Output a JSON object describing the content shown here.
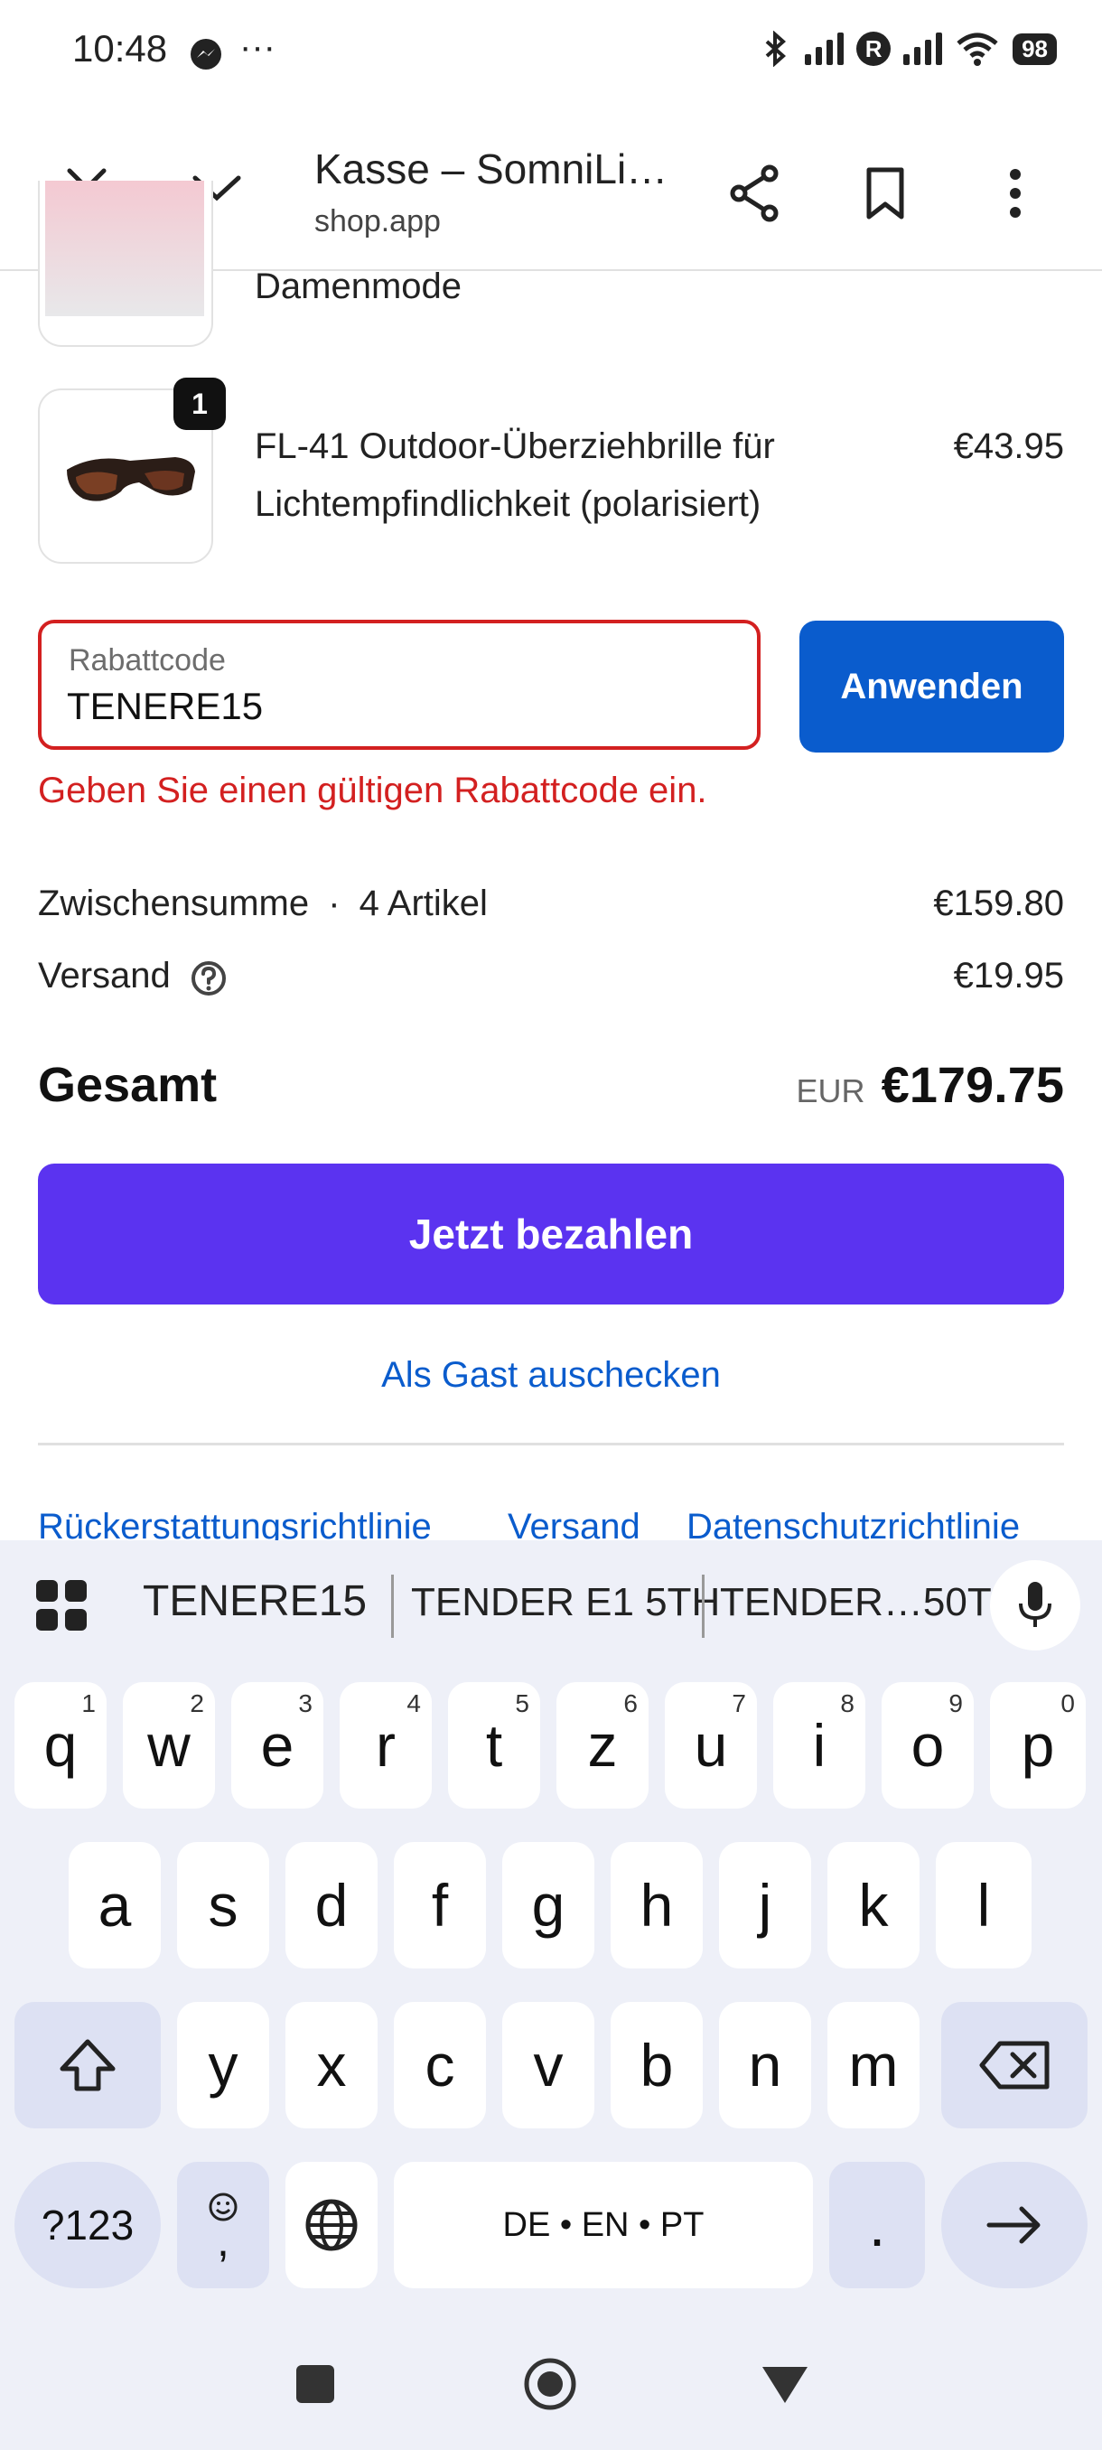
{
  "status": {
    "time": "10:48",
    "battery": "98",
    "r_badge": "R"
  },
  "header": {
    "title": "Kasse – SomniLi…",
    "url": "shop.app"
  },
  "items": [
    {
      "name": "Damenmode"
    },
    {
      "name_line1": "FL-41 Outdoor-Überziehbrille für",
      "name_line2": "Lichtempfindlichkeit (polarisiert)",
      "price": "€43.95",
      "qty": "1"
    }
  ],
  "discount": {
    "label": "Rabattcode",
    "value": "TENERE15",
    "apply": "Anwenden",
    "error": "Geben Sie einen gültigen Rabattcode ein."
  },
  "summary": {
    "subtotal_label": "Zwischensumme",
    "subtotal_count": "4 Artikel",
    "subtotal_value": "€159.80",
    "shipping_label": "Versand",
    "shipping_value": "€19.95",
    "total_label": "Gesamt",
    "currency": "EUR",
    "total_value": "€179.75"
  },
  "pay_button": "Jetzt bezahlen",
  "guest_link": "Als Gast auschecken",
  "footer_links": [
    "Rückerstattungsrichtlinie",
    "Versand",
    "Datenschutzrichtlinie"
  ],
  "keyboard": {
    "suggestions": [
      "TENERE15",
      "TENDER E1 5TH",
      "TENDER…50TH"
    ],
    "row1": [
      {
        "k": "q",
        "n": "1"
      },
      {
        "k": "w",
        "n": "2"
      },
      {
        "k": "e",
        "n": "3"
      },
      {
        "k": "r",
        "n": "4"
      },
      {
        "k": "t",
        "n": "5"
      },
      {
        "k": "z",
        "n": "6"
      },
      {
        "k": "u",
        "n": "7"
      },
      {
        "k": "i",
        "n": "8"
      },
      {
        "k": "o",
        "n": "9"
      },
      {
        "k": "p",
        "n": "0"
      }
    ],
    "row2": [
      "a",
      "s",
      "d",
      "f",
      "g",
      "h",
      "j",
      "k",
      "l"
    ],
    "row3": [
      "y",
      "x",
      "c",
      "v",
      "b",
      "n",
      "m"
    ],
    "symbols": "?123",
    "comma": ",",
    "space": "DE • EN • PT",
    "period": "."
  },
  "colors": {
    "accent_blue": "#0a5ccd",
    "pay_purple": "#5b33f0",
    "error_red": "#d32020"
  }
}
